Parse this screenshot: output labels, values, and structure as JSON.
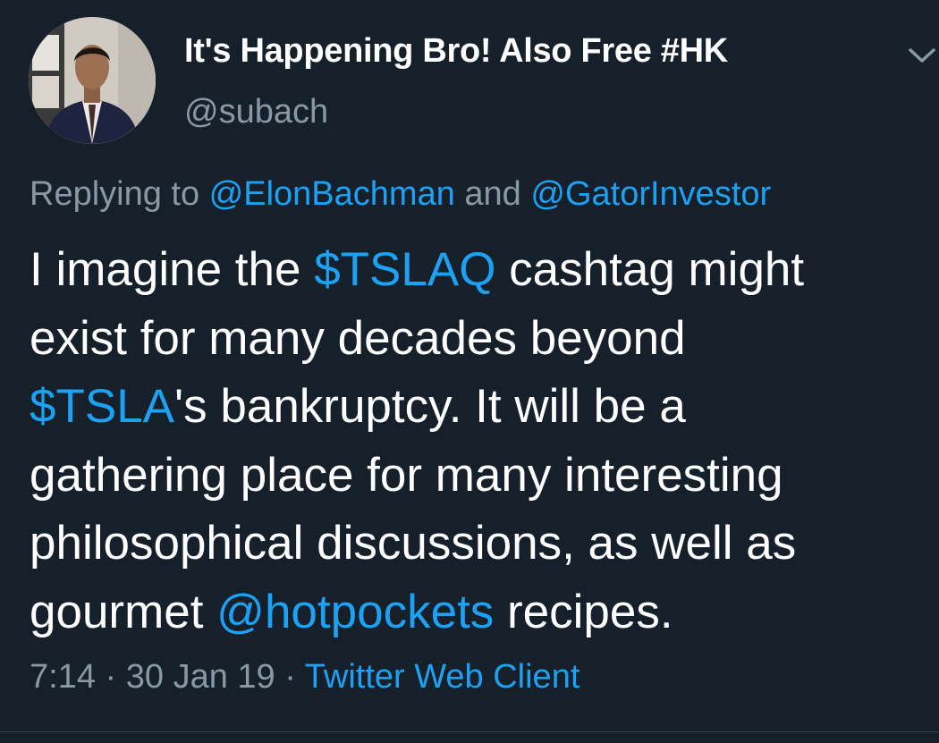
{
  "author": {
    "display_name": "It's Happening Bro! Also Free #HK",
    "handle": "@subach",
    "avatar_icon": "profile-photo"
  },
  "menu": {
    "icon": "chevron-down-icon"
  },
  "reply": {
    "prefix": "Replying to ",
    "mention_1": "@ElonBachman",
    "joiner": " and ",
    "mention_2": "@GatorInvestor"
  },
  "tweet": {
    "l1_a": "I imagine the ",
    "l1_link": "$TSLAQ",
    "l1_b": " cashtag might",
    "l2": "exist for many decades beyond",
    "l3_link": "$TSLA",
    "l3_b": "'s bankruptcy. It will be a",
    "l4": "gathering place for many interesting",
    "l5": "philosophical discussions, as well as",
    "l6_a": "gourmet ",
    "l6_link": "@hotpockets",
    "l6_b": " recipes."
  },
  "meta": {
    "time": "7:14",
    "sep1": " · ",
    "date": "30 Jan 19",
    "sep2": " · ",
    "source": "Twitter Web Client"
  },
  "colors": {
    "background": "#15202b",
    "text": "#ffffff",
    "secondary": "#8899a6",
    "link": "#1da1f2"
  }
}
